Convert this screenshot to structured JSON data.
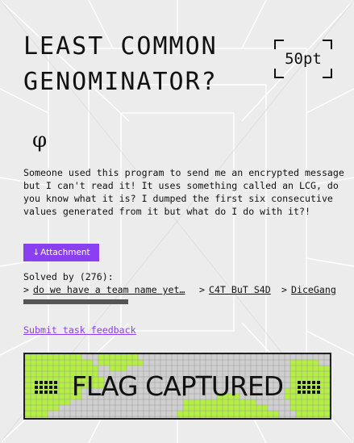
{
  "challenge": {
    "title": "LEAST COMMON\nGENOMINATOR?",
    "points": "50pt",
    "icon": "phi-icon",
    "icon_glyph": "φ",
    "description": "Someone used this program to send me an encrypted message but I can't read it! It uses something called an LCG, do you know what it is? I dumped the first six consecutive values generated from it but what do I do with it?!"
  },
  "attachment": {
    "icon": "download-arrow-icon",
    "icon_glyph": "↓",
    "label": "Attachment"
  },
  "solved": {
    "label": "Solved by (276):",
    "arrow": ">",
    "teams": [
      "do we have a team name yet…",
      "C4T BuT S4D",
      "DiceGang"
    ]
  },
  "feedback": {
    "label": "Submit task feedback"
  },
  "banner": {
    "text": "FLAG CAPTURED",
    "left_marker": "▩",
    "right_marker": "▩"
  },
  "colors": {
    "accent": "#8a3ff0",
    "banner_green": "#b4f041",
    "background": "#ececec"
  }
}
